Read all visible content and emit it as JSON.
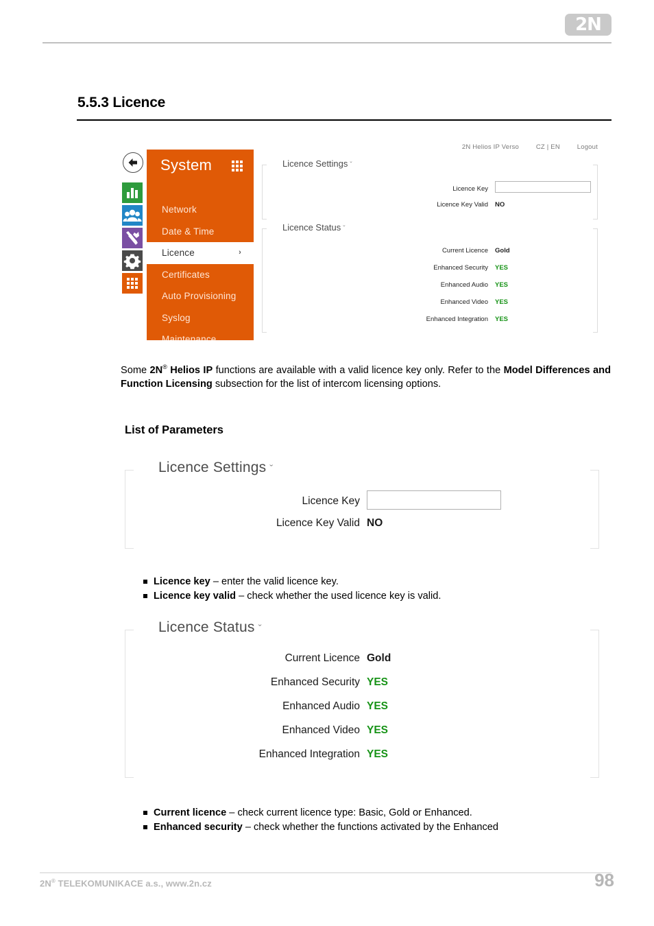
{
  "document": {
    "logo": "2N",
    "section_number_title": "5.5.3 Licence",
    "sub_title": "List of Parameters",
    "paragraph": {
      "part1": "Some ",
      "bold1": "2N",
      "sup1": "®",
      "bold1b": " Helios IP",
      "part2": " functions are available with a valid licence key only. Refer to the ",
      "bold2": "Model Differences and Function Licensing",
      "part3": " subsection for the list of intercom licensing options."
    },
    "bullets_settings": [
      {
        "term": "Licence key",
        "desc": " – enter the valid licence key."
      },
      {
        "term": "Licence key valid",
        "desc": " – check whether the used licence key is valid."
      }
    ],
    "bullets_status": [
      {
        "term": "Current licence",
        "desc": " – check current licence type: Basic, Gold or Enhanced."
      },
      {
        "term": "Enhanced security",
        "desc": " – check whether the functions activated by the Enhanced"
      }
    ],
    "footer": {
      "company": "2N",
      "company_sup": "®",
      "company_rest": " TELEKOMUNIKACE a.s., www.2n.cz",
      "page_number": "98"
    }
  },
  "screenshot": {
    "topbar": {
      "device": "2N Helios IP Verso",
      "language": "CZ | EN",
      "logout": "Logout"
    },
    "back_button_icon": "arrow-left-icon",
    "menu": {
      "title": "System",
      "grid_icon": "grid-icon",
      "items": [
        {
          "label": "Network",
          "active": false
        },
        {
          "label": "Date & Time",
          "active": false
        },
        {
          "label": "Licence",
          "active": true
        },
        {
          "label": "Certificates",
          "active": false
        },
        {
          "label": "Auto Provisioning",
          "active": false
        },
        {
          "label": "Syslog",
          "active": false
        },
        {
          "label": "Maintenance",
          "active": false
        }
      ]
    },
    "rail_icons": [
      {
        "name": "bar-chart-icon",
        "color": "#2e9b3d"
      },
      {
        "name": "users-icon",
        "color": "#2186c6"
      },
      {
        "name": "tools-icon",
        "color": "#7a4fa3"
      },
      {
        "name": "gear-icon",
        "color": "#4a4a4a"
      },
      {
        "name": "grid-icon",
        "color": "#e05a06"
      }
    ],
    "licence_settings": {
      "legend": "Licence Settings",
      "caret": "ˇ",
      "key_label": "Licence Key",
      "key_value": "",
      "valid_label": "Licence Key Valid",
      "valid_value": "NO"
    },
    "licence_status": {
      "legend": "Licence Status",
      "caret": "ˇ",
      "rows": [
        {
          "label": "Current Licence",
          "value": "Gold",
          "green": false
        },
        {
          "label": "Enhanced Security",
          "value": "YES",
          "green": true
        },
        {
          "label": "Enhanced Audio",
          "value": "YES",
          "green": true
        },
        {
          "label": "Enhanced Video",
          "value": "YES",
          "green": true
        },
        {
          "label": "Enhanced Integration",
          "value": "YES",
          "green": true
        }
      ]
    }
  },
  "big_licence_settings": {
    "legend": "Licence Settings",
    "caret": "ˇ",
    "key_label": "Licence Key",
    "key_value": "",
    "valid_label": "Licence Key Valid",
    "valid_value": "NO"
  },
  "big_licence_status": {
    "legend": "Licence Status",
    "caret": "ˇ",
    "rows": [
      {
        "label": "Current Licence",
        "value": "Gold",
        "green": false
      },
      {
        "label": "Enhanced Security",
        "value": "YES",
        "green": true
      },
      {
        "label": "Enhanced Audio",
        "value": "YES",
        "green": true
      },
      {
        "label": "Enhanced Video",
        "value": "YES",
        "green": true
      },
      {
        "label": "Enhanced Integration",
        "value": "YES",
        "green": true
      }
    ]
  },
  "colors": {
    "orange": "#e05a06",
    "green": "#179317",
    "gray_logo": "#c9c9c9",
    "footer_gray": "#b7b7b7"
  }
}
